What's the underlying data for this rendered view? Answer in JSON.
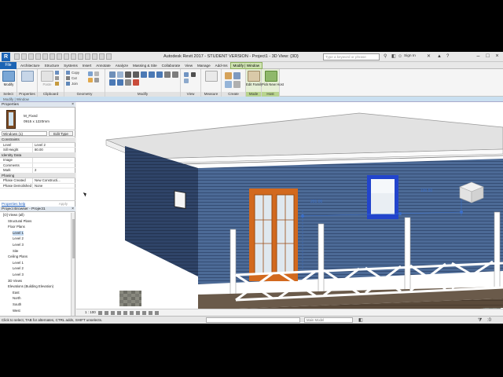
{
  "app": {
    "title": "Autodesk Revit 2017 - STUDENT VERSION -  Project1 - 3D View: {3D}",
    "logo_letter": "R",
    "search_placeholder": "Type a keyword or phrase",
    "sign_in": "Sign In"
  },
  "tabs": {
    "file": "File",
    "items": [
      "Architecture",
      "Structure",
      "Systems",
      "Insert",
      "Annotate",
      "Analyze",
      "Massing & Site",
      "Collaborate",
      "View",
      "Manage",
      "Add-Ins",
      "Modify | Window"
    ]
  },
  "ribbon": {
    "modify_label": "Modify",
    "clipboard_paste": "Paste",
    "clipboard_copy": "Copy",
    "clipboard_cut": "Cut",
    "clipboard_join": "Join",
    "edit_family": "Edit Family",
    "pick_new_host": "Pick New Host",
    "groups": {
      "select": "Select",
      "properties": "Properties",
      "clipboard": "Clipboard",
      "geometry": "Geometry",
      "modify": "Modify",
      "view": "View",
      "measure": "Measure",
      "create": "Create",
      "mode": "Mode",
      "host": "Host"
    }
  },
  "options_bar": "Modify | Window",
  "properties": {
    "header": "Properties",
    "family": "M_Fixed",
    "type": "0915 x 1220mm",
    "instance_selector": "Windows (1)",
    "edit_type": "Edit Type",
    "sections": {
      "constraints": "Constraints",
      "identity": "Identity Data",
      "phasing": "Phasing"
    },
    "constraints": [
      {
        "key": "Level",
        "value": "Level 2"
      },
      {
        "key": "Sill Height",
        "value": "80.00"
      }
    ],
    "identity": [
      {
        "key": "Image",
        "value": ""
      },
      {
        "key": "Comments",
        "value": ""
      },
      {
        "key": "Mark",
        "value": "2"
      }
    ],
    "phasing": [
      {
        "key": "Phase Created",
        "value": "New Constructi..."
      },
      {
        "key": "Phase Demolished",
        "value": "None"
      }
    ],
    "help_link": "Properties help",
    "apply": "Apply"
  },
  "browser": {
    "header": "Project Browser - Project1",
    "items": [
      {
        "label": "[O] Views (all)",
        "level": 0
      },
      {
        "label": "Structural Plans",
        "level": 1
      },
      {
        "label": "Floor Plans",
        "level": 1
      },
      {
        "label": "Level 1",
        "level": 2,
        "selected": true
      },
      {
        "label": "Level 2",
        "level": 2
      },
      {
        "label": "Level 3",
        "level": 2
      },
      {
        "label": "Site",
        "level": 2
      },
      {
        "label": "Ceiling Plans",
        "level": 1
      },
      {
        "label": "Level 1",
        "level": 2
      },
      {
        "label": "Level 2",
        "level": 2
      },
      {
        "label": "Level 3",
        "level": 2
      },
      {
        "label": "3D Views",
        "level": 1
      },
      {
        "label": "Elevations (Building Elevation)",
        "level": 1
      },
      {
        "label": "East",
        "level": 2
      },
      {
        "label": "North",
        "level": 2
      },
      {
        "label": "South",
        "level": 2
      },
      {
        "label": "West",
        "level": 2
      }
    ]
  },
  "viewport": {
    "dim_left": "201.00",
    "dim_right": "190.50"
  },
  "view_bar": {
    "scale": "1 : 100"
  },
  "status": {
    "text": "Click to select, TAB for alternates, CTRL adds, SHIFT unselects.",
    "model": "Main Model"
  },
  "colors": {
    "revit_blue": "#1c64b4",
    "contextual_green": "#b9d48f",
    "wall_blue": "#44608a",
    "door_orange": "#d2691e",
    "selection_blue": "#2244cc"
  }
}
